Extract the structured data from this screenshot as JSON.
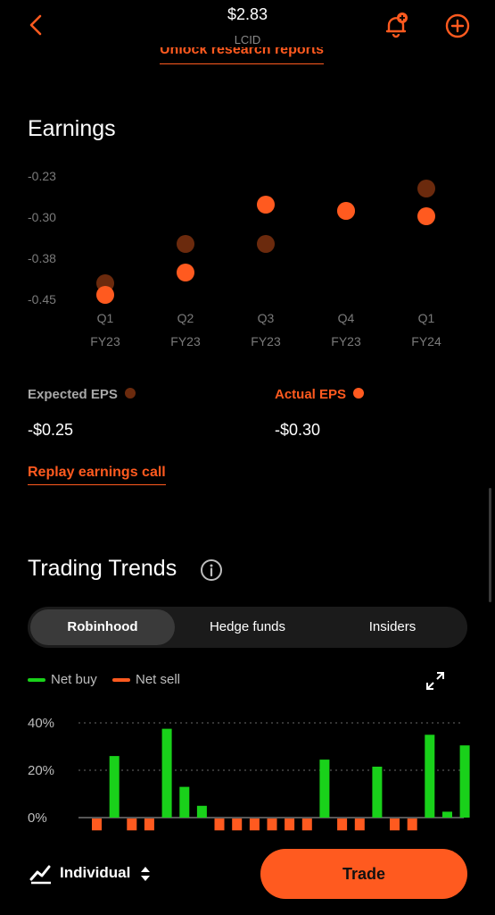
{
  "header": {
    "price": "$2.83",
    "ticker": "LCID",
    "back_icon": "chevron-left-icon",
    "alert_icon": "bell-plus-icon",
    "add_icon": "plus-circle-icon",
    "accent": "#ff5a1f"
  },
  "research": {
    "link_label": "Unlock research reports"
  },
  "earnings": {
    "title": "Earnings",
    "expected_label": "Expected EPS",
    "actual_label": "Actual EPS",
    "expected_value": "-$0.25",
    "actual_value": "-$0.30",
    "replay_label": "Replay earnings call",
    "expected_color": "#6b2a0d",
    "actual_color": "#ff5a1f"
  },
  "trading_trends": {
    "title": "Trading Trends",
    "info_icon": "info-icon",
    "tabs": [
      "Robinhood",
      "Hedge funds",
      "Insiders"
    ],
    "selected_tab": "Robinhood",
    "legend": [
      {
        "name": "Net buy",
        "color": "#19d11a"
      },
      {
        "name": "Net sell",
        "color": "#ff5a1f"
      }
    ],
    "expand_icon": "expand-icon"
  },
  "bottom": {
    "mode_icon": "chart-line-icon",
    "mode_label": "Individual",
    "trade_label": "Trade"
  },
  "chart_data": [
    {
      "type": "scatter",
      "y_ticks": [
        "-0.23",
        "-0.30",
        "-0.38",
        "-0.45"
      ],
      "ylim": [
        -0.45,
        -0.23
      ],
      "categories": [
        [
          "Q1",
          "FY23"
        ],
        [
          "Q2",
          "FY23"
        ],
        [
          "Q3",
          "FY23"
        ],
        [
          "Q4",
          "FY23"
        ],
        [
          "Q1",
          "FY24"
        ]
      ],
      "series": [
        {
          "name": "Expected EPS",
          "values": [
            -0.42,
            -0.35,
            -0.35,
            -0.29,
            -0.25
          ]
        },
        {
          "name": "Actual EPS",
          "values": [
            -0.44,
            -0.4,
            -0.28,
            -0.29,
            -0.3
          ]
        }
      ]
    },
    {
      "type": "bar",
      "y_ticks": [
        "40%",
        "20%",
        "0%"
      ],
      "ylim": [
        -5,
        40
      ],
      "values": [
        -5,
        26,
        -5,
        -5,
        37.5,
        13,
        5,
        -5,
        -5,
        -5,
        -5,
        -5,
        -5,
        24.5,
        -5,
        -5,
        21.5,
        -5,
        -5,
        35,
        2.5,
        30.5
      ],
      "series": [
        {
          "name": "Net buy"
        },
        {
          "name": "Net sell"
        }
      ]
    }
  ]
}
